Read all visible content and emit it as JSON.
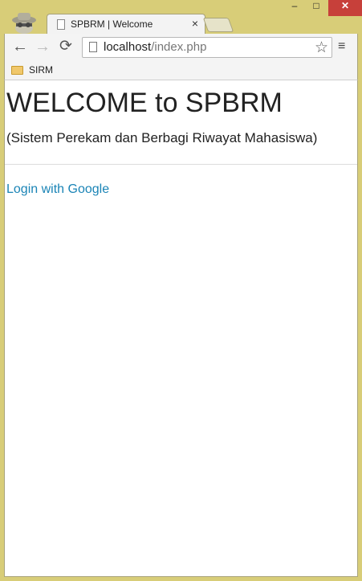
{
  "window": {
    "minimize": "‒",
    "maximize": "□",
    "close": "✕"
  },
  "tab": {
    "title": "SPBRM | Welcome",
    "close": "×"
  },
  "toolbar": {
    "url_host": "localhost",
    "url_path": "/index.php",
    "back": "←",
    "forward": "→",
    "reload": "⟳",
    "star": "☆",
    "menu": "≡"
  },
  "bookmarks": [
    {
      "label": "SIRM"
    }
  ],
  "page": {
    "heading": "WELCOME to SPBRM",
    "subtitle": "(Sistem Perekam dan Berbagi Riwayat Mahasiswa)",
    "login_link": "Login with Google",
    "link_color": "#1a84b6"
  }
}
